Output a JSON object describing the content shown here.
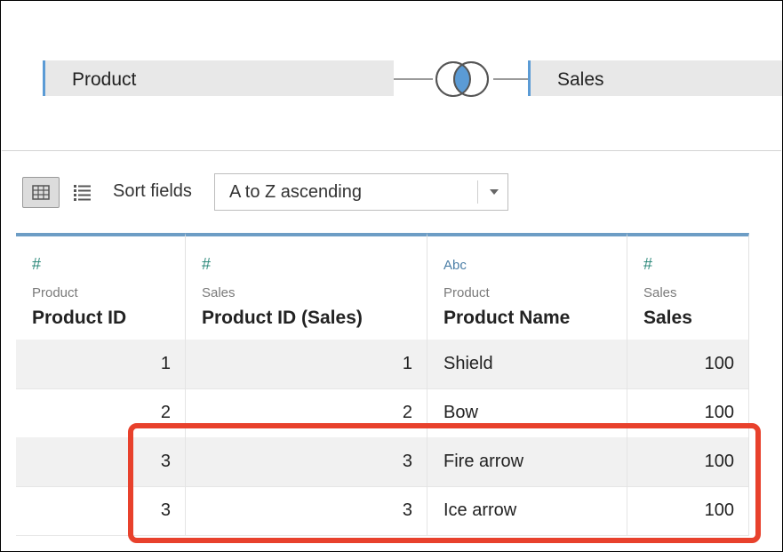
{
  "join": {
    "left_table": "Product",
    "right_table": "Sales",
    "join_type_icon": "inner-join-venn-icon"
  },
  "toolbar": {
    "grid_view_icon": "grid-view-icon",
    "list_view_icon": "list-view-icon",
    "sort_label": "Sort fields",
    "sort_value": "A to Z ascending"
  },
  "columns": [
    {
      "type_icon": "#",
      "source": "Product",
      "name": "Product ID",
      "align": "right"
    },
    {
      "type_icon": "#",
      "source": "Sales",
      "name": "Product ID (Sales)",
      "align": "right"
    },
    {
      "type_icon": "Abc",
      "source": "Product",
      "name": "Product Name",
      "align": "left"
    },
    {
      "type_icon": "#",
      "source": "Sales",
      "name": "Sales",
      "align": "right"
    }
  ],
  "rows": [
    [
      "1",
      "1",
      "Shield",
      "100"
    ],
    [
      "2",
      "2",
      "Bow",
      "100"
    ],
    [
      "3",
      "3",
      "Fire arrow",
      "100"
    ],
    [
      "3",
      "3",
      "Ice arrow",
      "100"
    ]
  ],
  "colors": {
    "accent": "#5b9bd5",
    "highlight": "#e8412c",
    "number_type_icon": "#2f8a7c"
  }
}
